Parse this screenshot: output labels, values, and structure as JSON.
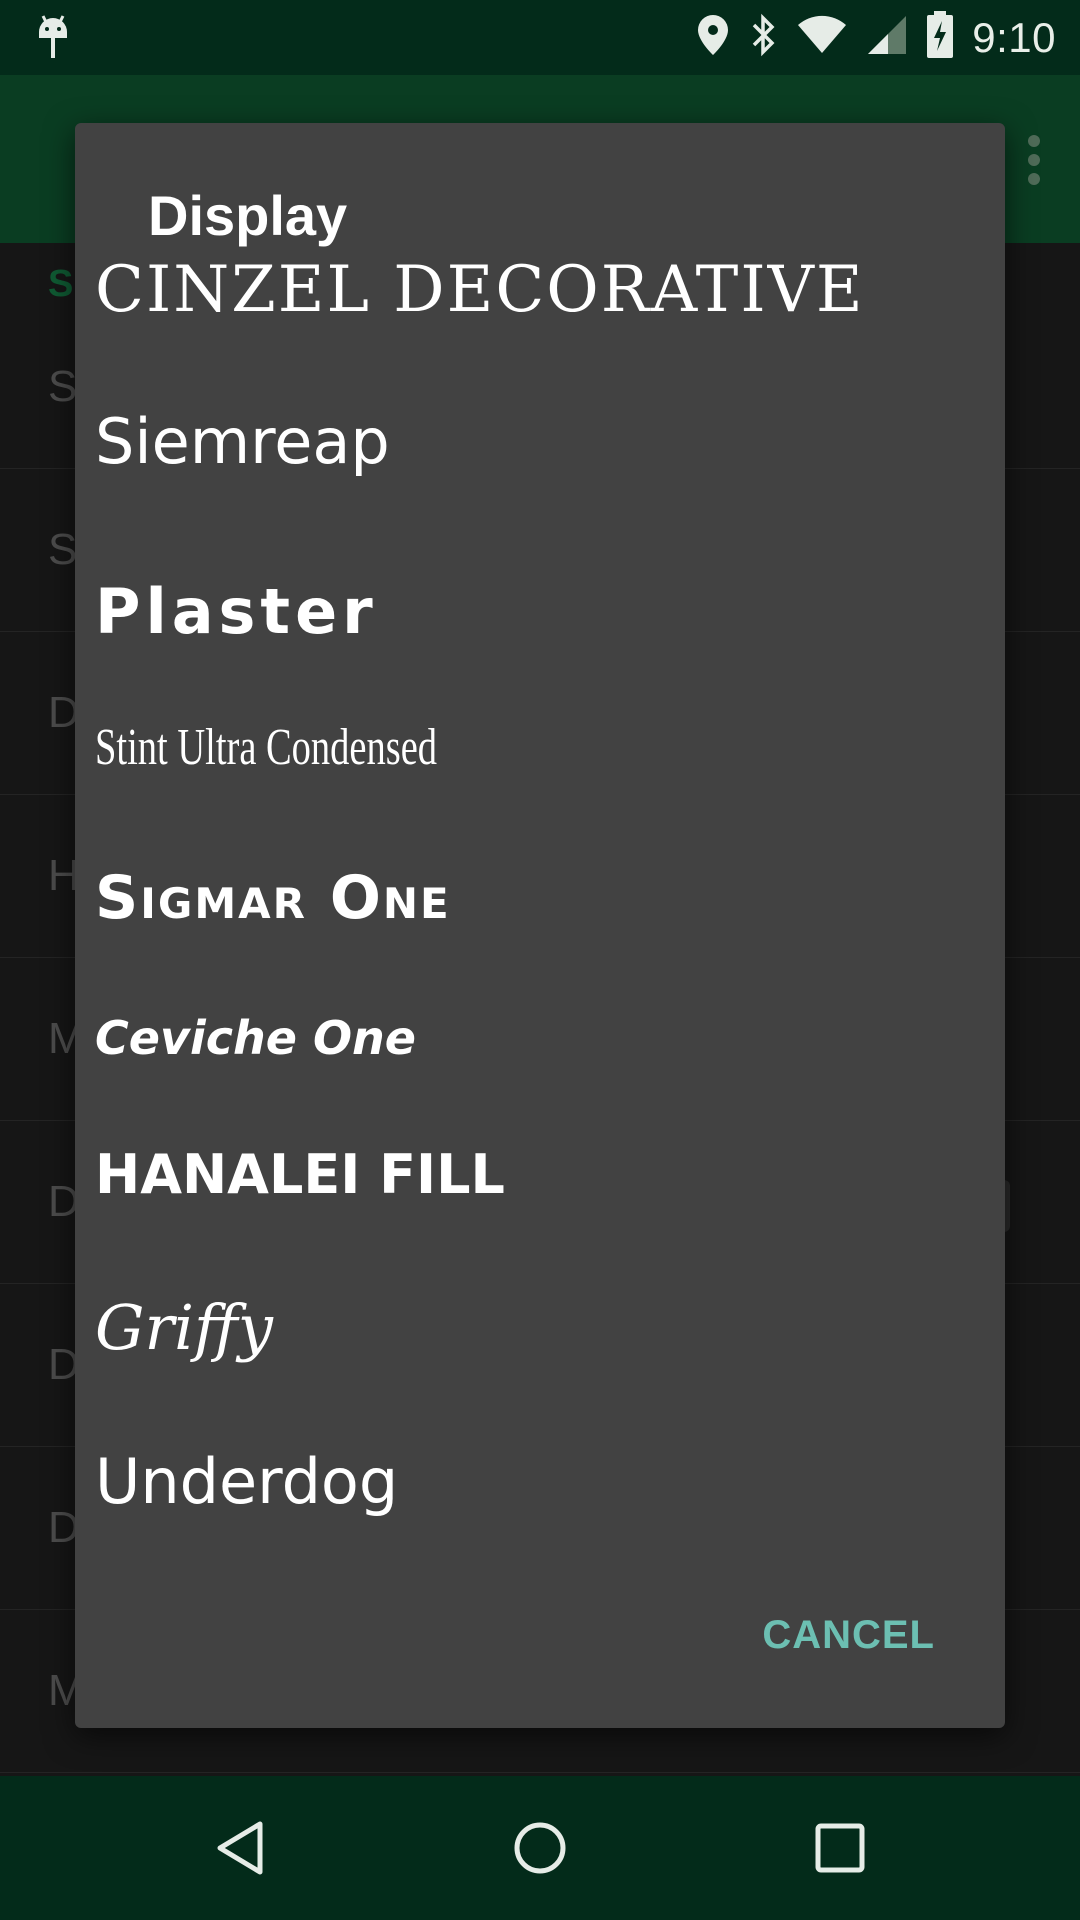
{
  "status_bar": {
    "time": "9:10",
    "icons": [
      "android-icon",
      "location-icon",
      "bluetooth-icon",
      "wifi-icon",
      "cell-signal-icon",
      "battery-charging-icon"
    ]
  },
  "background": {
    "section_header": "S",
    "rows": [
      "S",
      "S",
      "D",
      "H",
      "M",
      "D",
      "D",
      "D",
      "M"
    ]
  },
  "dialog": {
    "title": "Display",
    "fonts": [
      "CINZEL DECORATIVE",
      "Siemreap",
      "Plaster",
      "Stint Ultra Condensed",
      "Sigmar One",
      "Ceviche One",
      "HANALEI FILL",
      "Griffy",
      "Underdog"
    ],
    "cancel_label": "CANCEL"
  },
  "colors": {
    "status_bar": "#032b1a",
    "app_bar": "#0a3d22",
    "dialog_bg": "#424242",
    "accent": "#6cbfb2"
  },
  "nav_bar": {
    "icons": [
      "back-icon",
      "home-icon",
      "recents-icon"
    ]
  }
}
